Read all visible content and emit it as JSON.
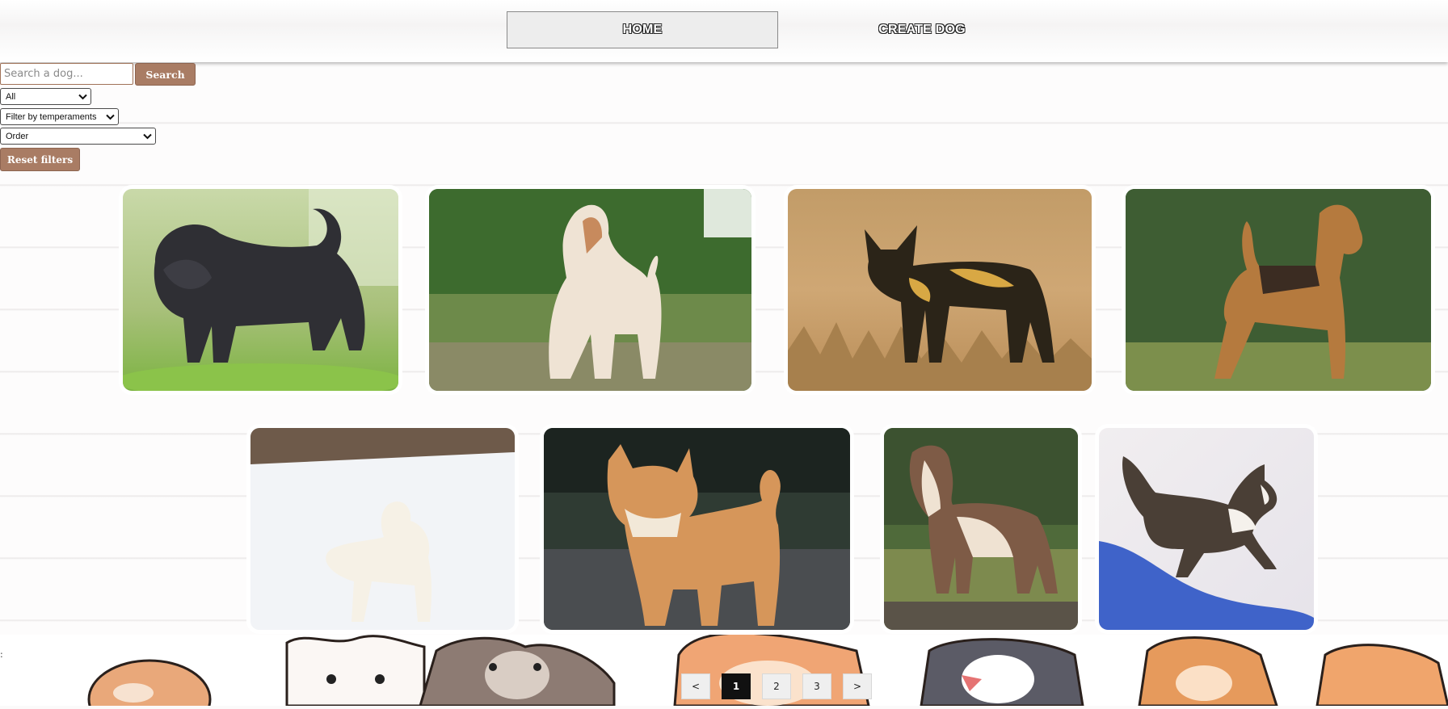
{
  "nav": {
    "home_label": "HOME",
    "create_label": "CREATE DOG"
  },
  "filters": {
    "search_placeholder": "Search a dog...",
    "search_button": "Search",
    "source_select": "All",
    "temperament_select": "Filter by temperaments",
    "order_select": "Order",
    "reset_button": "Reset filters"
  },
  "stray_text": ":",
  "cards": [
    {
      "subject": "affenpinscher photo"
    },
    {
      "subject": "afghan hound photo"
    },
    {
      "subject": "african wild dog photo"
    },
    {
      "subject": "airedale terrier photo"
    },
    {
      "subject": "white retriever in snow photo"
    },
    {
      "subject": "akita photo"
    },
    {
      "subject": "bulldog on leash photo"
    },
    {
      "subject": "husky in snow photo"
    }
  ],
  "pagination": {
    "prev": "<",
    "pages": [
      "1",
      "2",
      "3"
    ],
    "next": ">",
    "current": "1"
  },
  "colors": {
    "accent_brown": "#a97c64",
    "page_bg": "#fbfafa",
    "active_page": "#111111"
  }
}
